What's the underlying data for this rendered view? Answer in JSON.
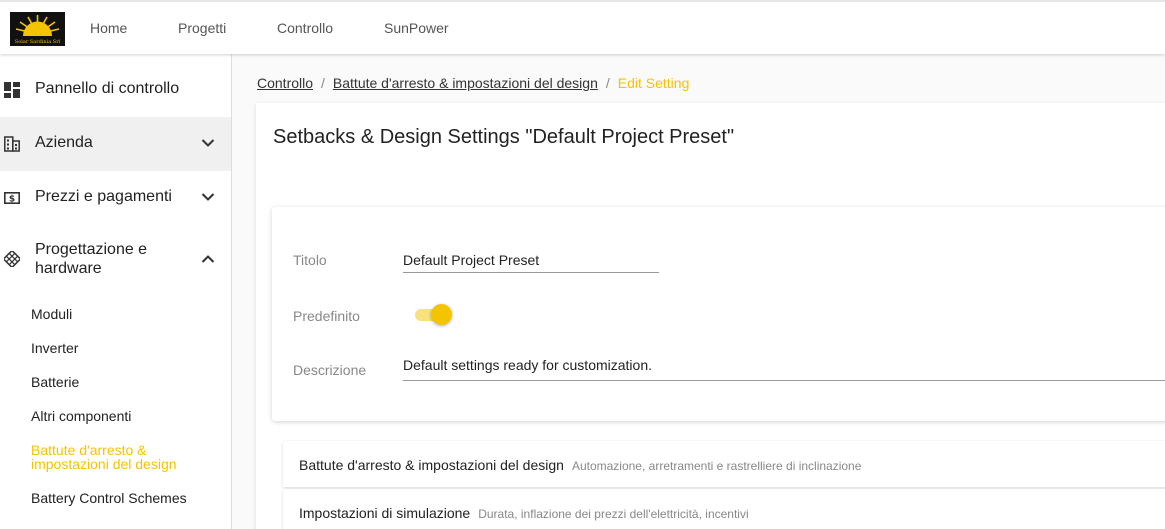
{
  "header": {
    "logo_text": "Solar Sardinia Srl",
    "nav": [
      "Home",
      "Progetti",
      "Controllo",
      "SunPower"
    ]
  },
  "sidebar": {
    "items": [
      {
        "label": "Pannello di controllo",
        "icon": "dashboard-icon"
      },
      {
        "label": "Azienda",
        "icon": "building-icon"
      },
      {
        "label": "Prezzi e pagamenti",
        "icon": "dollar-bill-icon"
      },
      {
        "label": "Progettazione e hardware",
        "icon": "solar-panel-icon"
      }
    ],
    "subitems": [
      "Moduli",
      "Inverter",
      "Batterie",
      "Altri componenti",
      "Battute d'arresto & impostazioni del design",
      "Battery Control Schemes"
    ]
  },
  "breadcrumb": {
    "items": [
      "Controllo",
      "Battute d'arresto & impostazioni del design"
    ],
    "current": "Edit Setting"
  },
  "page": {
    "title": "Setbacks & Design Settings \"Default Project Preset\""
  },
  "form": {
    "title_label": "Titolo",
    "title_value": "Default Project Preset",
    "default_label": "Predefinito",
    "default_on": true,
    "description_label": "Descrizione",
    "description_value": "Default settings ready for customization."
  },
  "sections": [
    {
      "title": "Battute d'arresto & impostazioni del design",
      "subtitle": "Automazione, arretramenti e rastrelliere di inclinazione"
    },
    {
      "title": "Impostazioni di simulazione",
      "subtitle": "Durata, inflazione dei prezzi dell'elettricità, incentivi"
    }
  ],
  "colors": {
    "accent": "#f5c400",
    "accent_light": "#f9e27a"
  }
}
